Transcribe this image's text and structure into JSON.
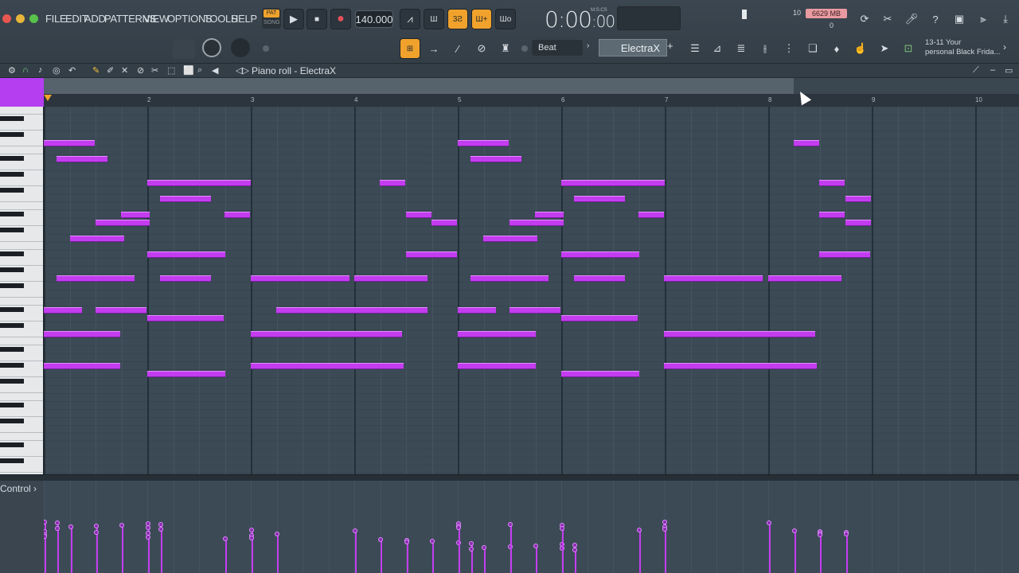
{
  "menu": [
    "FILE",
    "EDIT",
    "ADD",
    "PATTERNS",
    "VIEW",
    "OPTIONS",
    "TOOLS",
    "HELP"
  ],
  "transport": {
    "pat_label": "PAT",
    "song_label": "SONG",
    "tempo": "140.000",
    "time_main": "0:00",
    "time_frac": ":00",
    "time_unit": "M:S:CS"
  },
  "monitor": {
    "memory": "6629 MB",
    "polyphony": "10",
    "poly_zero": "0"
  },
  "pattern_selector": "Beat",
  "channel_selector": "ElectraX",
  "news": [
    "13-11  Your",
    "personal Black Frida..."
  ],
  "piano_roll": {
    "title": "Piano roll - ElectraX"
  },
  "ruler": [
    "2",
    "3",
    "4",
    "5",
    "6",
    "7",
    "8",
    "9",
    "10"
  ],
  "control": {
    "label": "Control"
  },
  "colors": {
    "note": "#c33cf0",
    "accent": "#f0a22c",
    "grid": "#3c4a56"
  }
}
